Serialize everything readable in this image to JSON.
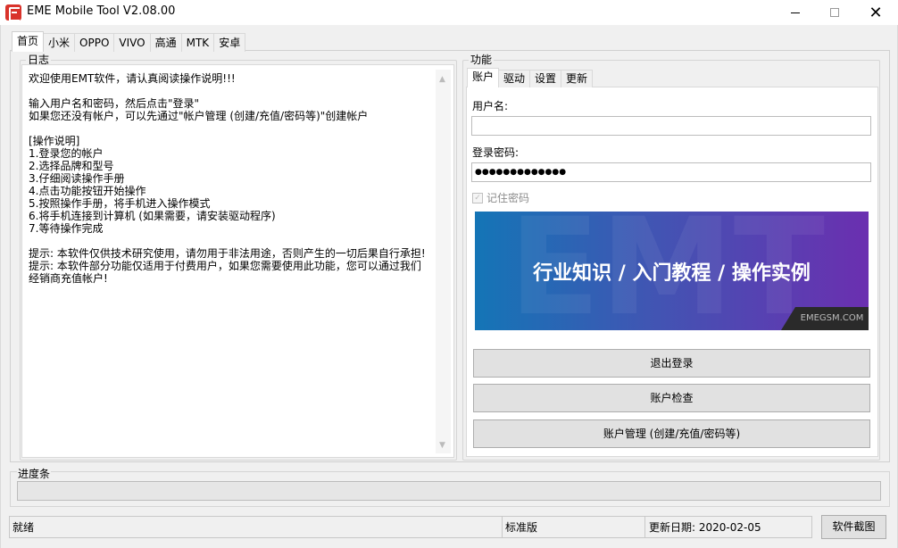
{
  "window": {
    "title": "EME Mobile Tool V2.08.00"
  },
  "main_tabs": [
    {
      "label": "首页"
    },
    {
      "label": "小米"
    },
    {
      "label": "OPPO"
    },
    {
      "label": "VIVO"
    },
    {
      "label": "高通"
    },
    {
      "label": "MTK"
    },
    {
      "label": "安卓"
    }
  ],
  "log": {
    "label": "日志",
    "text": "欢迎使用EMT软件，请认真阅读操作说明!!!\n\n输入用户名和密码，然后点击\"登录\"\n如果您还没有帐户，可以先通过\"帐户管理 (创建/充值/密码等)\"创建帐户\n\n[操作说明]\n1.登录您的帐户\n2.选择品牌和型号\n3.仔细阅读操作手册\n4.点击功能按钮开始操作\n5.按照操作手册，将手机进入操作模式\n6.将手机连接到计算机 (如果需要，请安装驱动程序)\n7.等待操作完成\n\n提示: 本软件仅供技术研究使用，请勿用于非法用途，否则产生的一切后果自行承担!\n提示: 本软件部分功能仅适用于付费用户，如果您需要使用此功能，您可以通过我们\n经销商充值帐户!"
  },
  "function": {
    "label": "功能",
    "tabs": [
      {
        "label": "账户"
      },
      {
        "label": "驱动"
      },
      {
        "label": "设置"
      },
      {
        "label": "更新"
      }
    ],
    "username_label": "用户名:",
    "username_value": "",
    "password_label": "登录密码:",
    "password_value": "●●●●●●●●●●●●●",
    "remember_label": "记住密码",
    "banner_text": "行业知识 / 入门教程 / 操作实例",
    "banner_site": "EMEGSM.COM",
    "buttons": {
      "logout": "退出登录",
      "check": "账户检查",
      "manage": "账户管理 (创建/充值/密码等)"
    }
  },
  "progress": {
    "label": "进度条",
    "value": 0
  },
  "status": {
    "state": "就绪",
    "edition": "标准版",
    "update_date": "更新日期: 2020-02-05",
    "screenshot_button": "软件截图"
  }
}
